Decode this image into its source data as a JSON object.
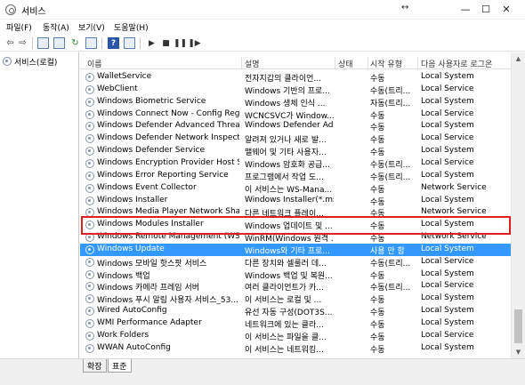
{
  "window": {
    "title": "서비스"
  },
  "menu": [
    "파일(F)",
    "동작(A)",
    "보기(V)",
    "도움말(H)"
  ],
  "toolbar_icons": [
    "back-arrow-icon",
    "forward-arrow-icon",
    "console-tree-icon",
    "properties-icon",
    "refresh-icon",
    "export-icon",
    "help-icon",
    "view-icon",
    "start-icon",
    "stop-icon",
    "pause-icon",
    "restart-icon"
  ],
  "tree": {
    "root_label": "서비스(로컬)"
  },
  "columns": {
    "name": "이름",
    "description": "설명",
    "status": "상태",
    "startup": "시작 유형",
    "logon": "다음 사용자로 로그온"
  },
  "services": [
    {
      "name": "WalletService",
      "description": "전자지갑의 클라이언...",
      "status": "",
      "startup": "수동",
      "logon": "Local System"
    },
    {
      "name": "WebClient",
      "description": "Windows 기반의 프로...",
      "status": "",
      "startup": "수동(트리...",
      "logon": "Local Service"
    },
    {
      "name": "Windows Biometric Service",
      "description": "Windows 생체 인식 ...",
      "status": "",
      "startup": "자동(트리...",
      "logon": "Local System"
    },
    {
      "name": "Windows Connect Now - Config Regis...",
      "description": "WCNCSVC가 Window...",
      "status": "",
      "startup": "수동",
      "logon": "Local Service"
    },
    {
      "name": "Windows Defender Advanced Threat P...",
      "description": "Windows Defender Ad...",
      "status": "",
      "startup": "수동",
      "logon": "Local System"
    },
    {
      "name": "Windows Defender Network Inspectio...",
      "description": "알려져 있거나 새로 발...",
      "status": "",
      "startup": "수동",
      "logon": "Local Service"
    },
    {
      "name": "Windows Defender Service",
      "description": "맬웨어 및 기타 사용자...",
      "status": "",
      "startup": "수동",
      "logon": "Local System"
    },
    {
      "name": "Windows Encryption Provider Host Ser...",
      "description": "Windows 암호화 공급...",
      "status": "",
      "startup": "수동(트리...",
      "logon": "Local Service"
    },
    {
      "name": "Windows Error Reporting Service",
      "description": "프로그램에서 작업 도...",
      "status": "",
      "startup": "수동(트리...",
      "logon": "Local System"
    },
    {
      "name": "Windows Event Collector",
      "description": "이 서비스는 WS-Mana...",
      "status": "",
      "startup": "수동",
      "logon": "Network Service"
    },
    {
      "name": "Windows Installer",
      "description": "Windows Installer(*.ms...",
      "status": "",
      "startup": "수동",
      "logon": "Local System"
    },
    {
      "name": "Windows Media Player Network Sharin...",
      "description": "다른 네트워크 플레이...",
      "status": "",
      "startup": "수동",
      "logon": "Network Service"
    },
    {
      "name": "Windows Modules Installer",
      "description": "Windows 업데이트 및 ...",
      "status": "",
      "startup": "수동",
      "logon": "Local System"
    },
    {
      "name": "Windows Remote Management (WS-...",
      "description": "WinRM(Windows 원격 ...",
      "status": "",
      "startup": "수동",
      "logon": "Network Service"
    },
    {
      "name": "Windows Update",
      "description": "Windows와 기타 프로...",
      "status": "",
      "startup": "사용 안 함",
      "logon": "Local System"
    },
    {
      "name": "Windows 모바일 핫스팟 서비스",
      "description": "다른 장치와 셀룰러 데...",
      "status": "",
      "startup": "수동(트리...",
      "logon": "Local Service"
    },
    {
      "name": "Windows 백업",
      "description": "Windows 백업 및 복원...",
      "status": "",
      "startup": "수동",
      "logon": "Local System"
    },
    {
      "name": "Windows 카메라 프레임 서버",
      "description": "여러 클라이언트가 카...",
      "status": "",
      "startup": "수동(트리...",
      "logon": "Local Service"
    },
    {
      "name": "Windows 푸시 알림 사용자 서비스_53...",
      "description": "이 서비스는 로컬 및 ...",
      "status": "",
      "startup": "수동",
      "logon": "Local System"
    },
    {
      "name": "Wired AutoConfig",
      "description": "유선 자동 구성(DOT3S...",
      "status": "",
      "startup": "수동",
      "logon": "Local System"
    },
    {
      "name": "WMI Performance Adapter",
      "description": "네트워크에 있는 클라...",
      "status": "",
      "startup": "수동",
      "logon": "Local System"
    },
    {
      "name": "Work Folders",
      "description": "이 서비스는 파일을 클...",
      "status": "",
      "startup": "수동",
      "logon": "Local Service"
    },
    {
      "name": "WWAN AutoConfig",
      "description": "이 서비스는 네트워킹...",
      "status": "",
      "startup": "수동",
      "logon": "Local System"
    }
  ],
  "selected_service": "Windows Update",
  "tabs": [
    "확장",
    "표준"
  ],
  "colors": {
    "selection": "#3399ff",
    "highlight_box": "#e02020"
  }
}
